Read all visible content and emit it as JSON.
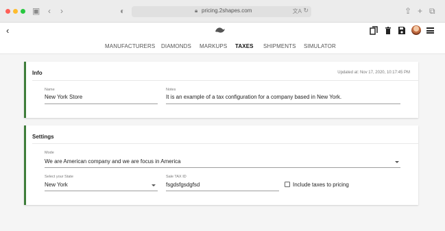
{
  "browser": {
    "url": "pricing.2shapes.com"
  },
  "nav": {
    "tabs": [
      {
        "label": "MANUFACTURERS"
      },
      {
        "label": "DIAMONDS"
      },
      {
        "label": "MARKUPS"
      },
      {
        "label": "TAXES",
        "active": true
      },
      {
        "label": "SHIPMENTS"
      },
      {
        "label": "SIMULATOR"
      }
    ]
  },
  "info": {
    "title": "Info",
    "updated": "Updated at: Nov 17, 2020, 10:17:45 PM",
    "name_label": "Name",
    "name_value": "New York Store",
    "notes_label": "Notes",
    "notes_value": "It is an example of a tax configuration for a company based in New York."
  },
  "settings": {
    "title": "Settings",
    "mode_label": "Mode",
    "mode_value": "We are American company and we are focus in America",
    "state_label": "Select your State",
    "state_value": "New York",
    "taxid_label": "Sale TAX ID",
    "taxid_value": "fsgdsfgsdgfsd",
    "include_taxes_label": "Include taxes to pricing",
    "include_taxes_checked": false
  },
  "colors": {
    "accent": "#3e7d3a"
  }
}
